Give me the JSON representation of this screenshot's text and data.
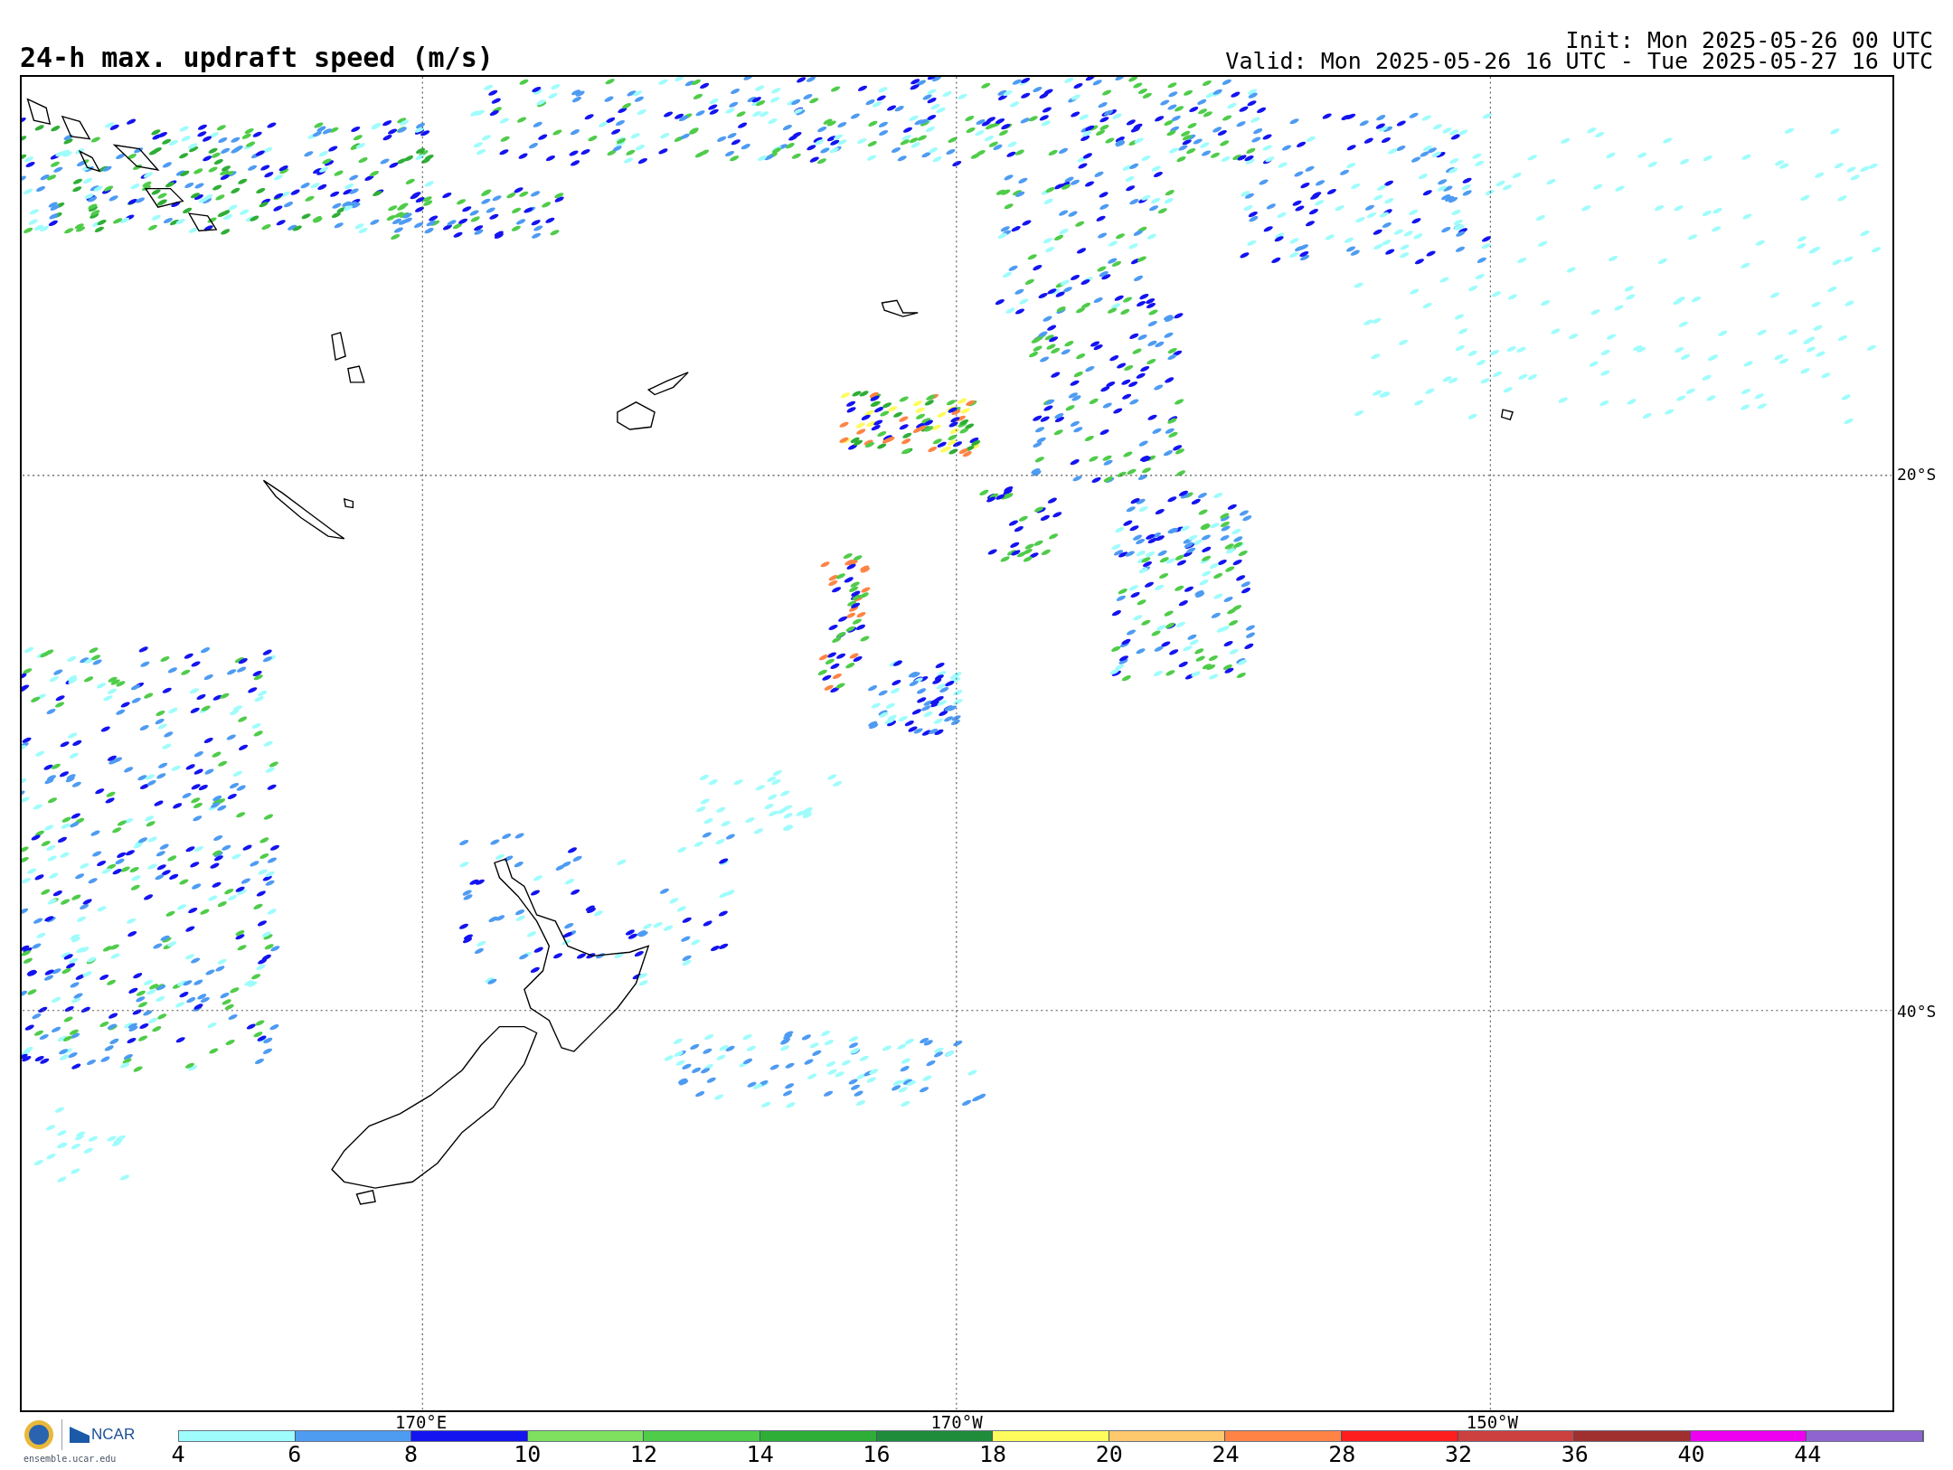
{
  "title": "24-h max. updraft speed (m/s)",
  "init": "Init: Mon 2025-05-26 00 UTC",
  "valid": "Valid: Mon 2025-05-26 16 UTC - Tue 2025-05-27 16 UTC",
  "longitude_labels": [
    "170°E",
    "170°W",
    "150°W"
  ],
  "latitude_labels": [
    "20°S",
    "40°S"
  ],
  "logo": {
    "text": "NCAR",
    "url": "ensemble.ucar.edu"
  },
  "legend": {
    "segments": [
      {
        "color": "#9ffcfc"
      },
      {
        "color": "#4e9bf2"
      },
      {
        "color": "#1414f0"
      },
      {
        "color": "#7ee05e"
      },
      {
        "color": "#4fcc4a"
      },
      {
        "color": "#2fae37"
      },
      {
        "color": "#1f8c3c"
      },
      {
        "color": "#fdfc5c"
      },
      {
        "color": "#fec86c"
      },
      {
        "color": "#fe8446"
      },
      {
        "color": "#fe1e1e"
      },
      {
        "color": "#cc4040"
      },
      {
        "color": "#a03030"
      },
      {
        "color": "#f000f0"
      },
      {
        "color": "#9064d0"
      }
    ],
    "ticks": [
      "4",
      "6",
      "8",
      "10",
      "12",
      "14",
      "16",
      "18",
      "20",
      "24",
      "28",
      "32",
      "36",
      "40",
      "44"
    ]
  }
}
